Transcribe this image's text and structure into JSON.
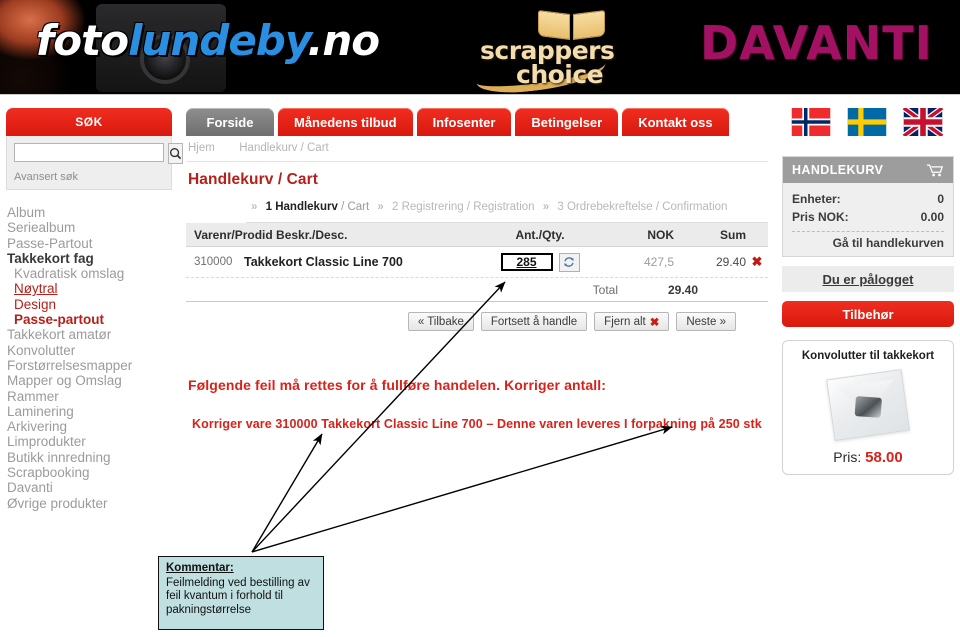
{
  "banner": {
    "logo_white_1": "foto",
    "logo_blue": "lundeby",
    "logo_white_2": ".no",
    "scrappers_line1": "scrappers",
    "scrappers_line2": "choice",
    "davanti": "DAVANTI"
  },
  "tabs": [
    {
      "label": "Forside",
      "active": true
    },
    {
      "label": "Månedens tilbud",
      "active": false
    },
    {
      "label": "Infosenter",
      "active": false
    },
    {
      "label": "Betingelser",
      "active": false
    },
    {
      "label": "Kontakt oss",
      "active": false
    }
  ],
  "flags": [
    {
      "name": "norway-flag"
    },
    {
      "name": "sweden-flag"
    },
    {
      "name": "uk-flag"
    }
  ],
  "search": {
    "header": "SØK",
    "value": "",
    "placeholder": "",
    "advanced_label": "Avansert søk",
    "icon": "search-icon"
  },
  "sidebar": {
    "items": [
      {
        "label": "Album",
        "style": "plain"
      },
      {
        "label": "Seriealbum",
        "style": "plain"
      },
      {
        "label": "Passe-Partout",
        "style": "plain"
      },
      {
        "label": "Takkekort fag",
        "style": "dark"
      },
      {
        "label": "Kvadratisk omslag",
        "style": "sub"
      },
      {
        "label": "Nøytral",
        "style": "sub red underline"
      },
      {
        "label": "Design",
        "style": "sub red"
      },
      {
        "label": "Passe-partout",
        "style": "sub red bold"
      },
      {
        "label": "Takkekort amatør",
        "style": "plain"
      },
      {
        "label": "Konvolutter",
        "style": "plain"
      },
      {
        "label": "Forstørrelsesmapper",
        "style": "plain"
      },
      {
        "label": "Mapper og Omslag",
        "style": "plain"
      },
      {
        "label": "Rammer",
        "style": "plain"
      },
      {
        "label": "Laminering",
        "style": "plain"
      },
      {
        "label": "Arkivering",
        "style": "plain"
      },
      {
        "label": "Limprodukter",
        "style": "plain"
      },
      {
        "label": "Butikk innredning",
        "style": "plain"
      },
      {
        "label": "Scrapbooking",
        "style": "plain"
      },
      {
        "label": "Davanti",
        "style": "plain"
      },
      {
        "label": "Øvrige produkter",
        "style": "plain"
      }
    ]
  },
  "main": {
    "breadcrumb_home": "Hjem",
    "breadcrumb_current": "Handlekurv / Cart",
    "page_title": "Handlekurv / Cart",
    "steps": [
      {
        "num": "1",
        "label_bold": "Handlekurv",
        "label_light": "/ Cart",
        "current": true
      },
      {
        "num": "2",
        "label": "Registrering / Registration",
        "current": false
      },
      {
        "num": "3",
        "label": "Ordrebekreftelse / Confirmation",
        "current": false
      }
    ],
    "table": {
      "headers": {
        "desc": "Varenr/Prodid Beskr./Desc.",
        "qty": "Ant./Qty.",
        "nok": "NOK",
        "sum": "Sum"
      },
      "rows": [
        {
          "prodid": "310000",
          "name": "Takkekort Classic Line 700",
          "qty": "285",
          "nok": "427,5",
          "sum": "29.40",
          "delete_icon": "close-x-icon",
          "refresh_icon": "refresh-icon"
        }
      ],
      "total_label": "Total",
      "total_value": "29.40"
    },
    "buttons": [
      {
        "label": "« Tilbake",
        "name": "back-button"
      },
      {
        "label": "Fortsett å handle",
        "name": "continue-shopping-button"
      },
      {
        "label": "Fjern alt",
        "name": "remove-all-button",
        "has_x": true
      },
      {
        "label": "Neste »",
        "name": "next-button"
      }
    ],
    "error_title": "Følgende feil må rettes for å fullføre handelen. Korriger antall:",
    "error_line": "Korriger vare 310000 Takkekort Classic Line 700 –  Denne varen  leveres I forpakning på  250 stk"
  },
  "cartwidget": {
    "title": "HANDLEKURV",
    "icon": "shopping-cart-icon",
    "units_label": "Enheter:",
    "units_value": "0",
    "price_label": "Pris NOK:",
    "price_value": "0.00",
    "goto_label": "Gå til handlekurven"
  },
  "account": {
    "logged_in_label": "Du er pålogget",
    "accessories_label": "Tilbehør"
  },
  "product_card": {
    "title": "Konvolutter  til takkekort",
    "image": "envelope-image",
    "price_label": "Pris:",
    "price_value": "58.00"
  },
  "annotation": {
    "heading": "Kommentar:",
    "text": "Feilmelding ved bestilling av feil kvantum i forhold til pakningstørrelse"
  },
  "colors": {
    "brand_red": "#d9190e",
    "logo_blue": "#2a8fe0",
    "error_red": "#d9221a",
    "davanti_magenta": "#a31262",
    "note_teal": "#bfdfe1"
  }
}
